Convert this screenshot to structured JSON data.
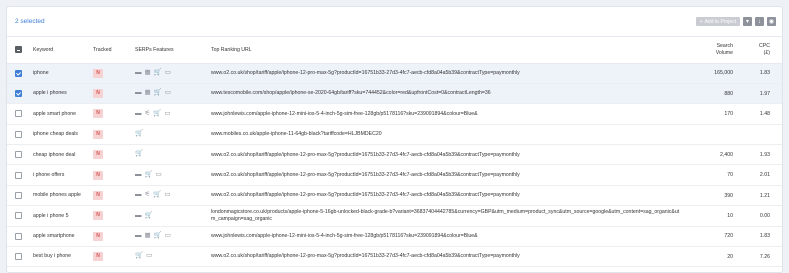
{
  "header": {
    "selected_text": "2 selected",
    "add_to_project_label": "Add to Project"
  },
  "columns": {
    "keyword": "Keyword",
    "tracked": "Tracked",
    "serp_features": "SERPs Features",
    "top_url": "Top Ranking URL",
    "search_volume": "Search\nVolume",
    "cpc": "CPC\n(£)"
  },
  "rows": [
    {
      "checked": true,
      "keyword": "iphone",
      "tracked": "N",
      "icons": [
        "image-icon",
        "video-icon",
        "cart-icon",
        "tv-icon"
      ],
      "url": "www.o2.co.uk/shop/tariff/apple/iphone-12-pro-max-5g?productId=16751b33-27d3-4fc7-aecb-cfd8a04a5b39&contractType=paymonthly",
      "volume": "165,000",
      "cpc": "1.83"
    },
    {
      "checked": true,
      "keyword": "apple i phones",
      "tracked": "N",
      "icons": [
        "image-icon",
        "video-icon",
        "cart-icon",
        "tv-icon"
      ],
      "url": "www.tescomobile.com/shop/apple/iphone-se-2020-64gb/tariff?sku=744452&color=red&upfrontCost=0&contractLength=36",
      "volume": "880",
      "cpc": "1.97"
    },
    {
      "checked": false,
      "keyword": "apple smart phone",
      "tracked": "N",
      "icons": [
        "image-icon",
        "share-icon",
        "cart-icon",
        "tv-icon"
      ],
      "url": "www.johnlewis.com/apple-iphone-12-mini-ios-5-4-inch-5g-sim-free-128gb/p5178116?sku=239091894&colour=Blue&",
      "volume": "170",
      "cpc": "1.48"
    },
    {
      "checked": false,
      "keyword": "iphone cheap deals",
      "tracked": "N",
      "icons": [
        "cart-icon"
      ],
      "url": "www.mobiles.co.uk/apple-iphone-11-64gb-black?tariffcode=HLJBMDEC20",
      "volume": "",
      "cpc": ""
    },
    {
      "checked": false,
      "keyword": "cheap iphone deal",
      "tracked": "N",
      "icons": [
        "cart-icon"
      ],
      "url": "www.o2.co.uk/shop/tariff/apple/iphone-12-pro-max-5g?productId=16751b33-27d3-4fc7-aecb-cfd8a04a5b39&contractType=paymonthly",
      "volume": "2,400",
      "cpc": "1.93"
    },
    {
      "checked": false,
      "keyword": "i phone offers",
      "tracked": "N",
      "icons": [
        "image-icon",
        "cart-icon",
        "tv-icon"
      ],
      "url": "www.o2.co.uk/shop/tariff/apple/iphone-12-pro-max-5g?productId=16751b33-27d3-4fc7-aecb-cfd8a04a5b39&contractType=paymonthly",
      "volume": "70",
      "cpc": "2.01"
    },
    {
      "checked": false,
      "keyword": "mobile phones apple",
      "tracked": "N",
      "icons": [
        "image-icon",
        "share-icon",
        "cart-icon",
        "tv-icon"
      ],
      "url": "www.o2.co.uk/shop/tariff/apple/iphone-12-pro-max-5g?productId=16751b33-27d3-4fc7-aecb-cfd8a04a5b39&contractType=paymonthly",
      "volume": "390",
      "cpc": "1.21"
    },
    {
      "checked": false,
      "keyword": "apple i phone 5",
      "tracked": "N",
      "icons": [
        "image-icon",
        "cart-icon"
      ],
      "url": "londonmagicstore.co.uk/products/apple-iphone-5-16gb-unlocked-black-grade-b?variant=36837404442785&currency=GBP&utm_medium=product_sync&utm_source=google&utm_content=sag_organic&utm_campaign=sag_organic",
      "volume": "10",
      "cpc": "0.00"
    },
    {
      "checked": false,
      "keyword": "apple smartphone",
      "tracked": "N",
      "icons": [
        "image-icon",
        "video-icon",
        "cart-icon",
        "tv-icon"
      ],
      "url": "www.johnlewis.com/apple-iphone-12-mini-ios-5-4-inch-5g-sim-free-128gb/p5178116?sku=239091894&colour=Blue&",
      "volume": "720",
      "cpc": "1.83"
    },
    {
      "checked": false,
      "keyword": "best buy i phone",
      "tracked": "N",
      "icons": [
        "cart-icon",
        "tv-icon"
      ],
      "url": "www.o2.co.uk/shop/tariff/apple/iphone-12-pro-max-5g?productId=16751b33-27d3-4fc7-aecb-cfd8a04a5b39&contractType=paymonthly",
      "volume": "20",
      "cpc": "7.26"
    }
  ],
  "icon_glyphs": {
    "image-icon": "▬",
    "video-icon": "▦",
    "share-icon": "⚟",
    "cart-icon": "🛒",
    "tv-icon": "▭"
  }
}
